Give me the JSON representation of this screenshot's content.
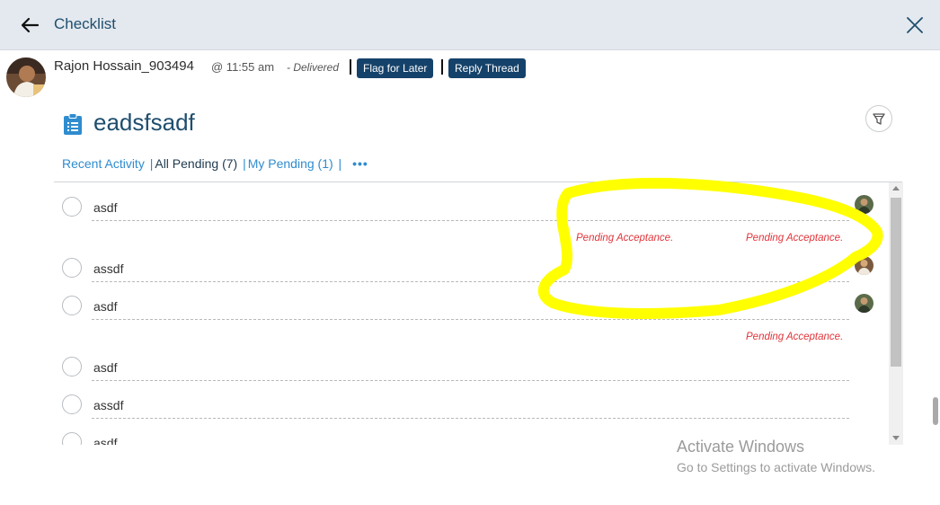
{
  "header": {
    "title": "Checklist"
  },
  "message": {
    "sender": "Rajon Hossain_903494",
    "time": "@ 11:55 am",
    "status": "- Delivered",
    "flag_label": "Flag for Later",
    "reply_label": "Reply Thread"
  },
  "checklist": {
    "title": "eadsfsadf",
    "tabs": {
      "recent": "Recent Activity",
      "all_pending": "All Pending (7)",
      "my_pending": "My Pending (1)",
      "more": "•••"
    },
    "items": [
      {
        "text": "asdf"
      },
      {
        "text": "assdf"
      },
      {
        "text": "asdf"
      },
      {
        "text": "asdf"
      },
      {
        "text": "assdf"
      },
      {
        "text": "asdf"
      }
    ],
    "pending_label": "Pending Acceptance."
  },
  "colors": {
    "accent": "#15426a",
    "link": "#2f8ccf",
    "pending": "#e0343a",
    "highlight": "#ffff00"
  },
  "watermark": {
    "title": "Activate Windows",
    "subtitle": "Go to Settings to activate Windows."
  }
}
